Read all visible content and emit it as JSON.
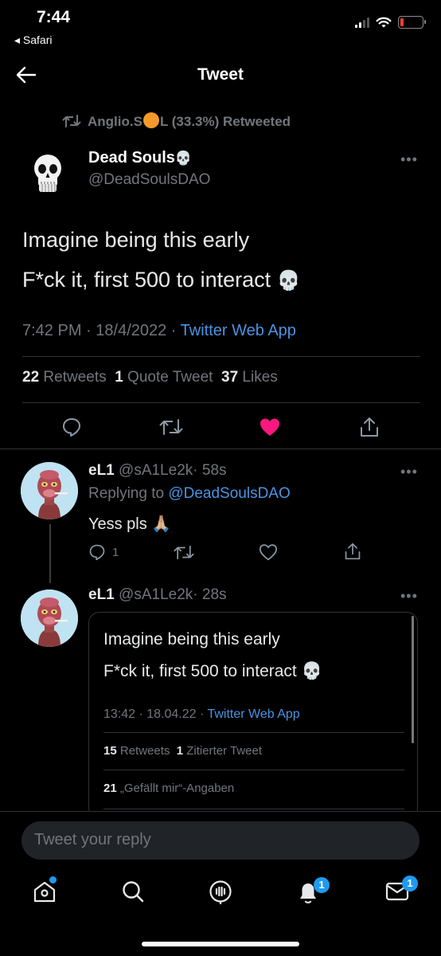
{
  "status_bar": {
    "time": "7:44",
    "back_app": "◂ Safari"
  },
  "header": {
    "title": "Tweet"
  },
  "retweet_banner": {
    "user_prefix": "Anglio.S",
    "user_suffix": "L (33.3%) Retweeted"
  },
  "tweet": {
    "author_name": "Dead Souls",
    "author_emoji": "💀",
    "author_handle": "@DeadSoulsDAO",
    "text_line1": "Imagine being this early",
    "text_line2": "F*ck it, first 500 to interact",
    "text_emoji": "💀",
    "time": "7:42 PM",
    "date": "18/4/2022",
    "source": "Twitter Web App",
    "stats": {
      "retweets_count": "22",
      "retweets_label": "Retweets",
      "quotes_count": "1",
      "quotes_label": "Quote Tweet",
      "likes_count": "37",
      "likes_label": "Likes"
    },
    "liked": true,
    "accent_like_color": "#f91880"
  },
  "replies": [
    {
      "name": "eL1",
      "handle": "@sA1Le2k",
      "age": "· 58s",
      "replying_prefix": "Replying to",
      "replying_to": "@DeadSoulsDAO",
      "text": "Yess pls 🙏🏼",
      "reply_count": "1"
    },
    {
      "name": "eL1",
      "handle": "@sA1Le2k",
      "age": "· 28s",
      "quote": {
        "line1": "Imagine being this early",
        "line2": "F*ck it, first 500 to interact 💀",
        "time": "13:42",
        "date": "18.04.22",
        "source": "Twitter Web App",
        "retweets_count": "15",
        "retweets_label": "Retweets",
        "quotes_count": "1",
        "quotes_label": "Zitierter Tweet",
        "likes_count": "21",
        "likes_label": "„Gefällt mir“-Angaben"
      }
    }
  ],
  "compose": {
    "placeholder": "Tweet your reply"
  },
  "tabbar": {
    "notifications_badge": "1",
    "messages_badge": "1"
  }
}
